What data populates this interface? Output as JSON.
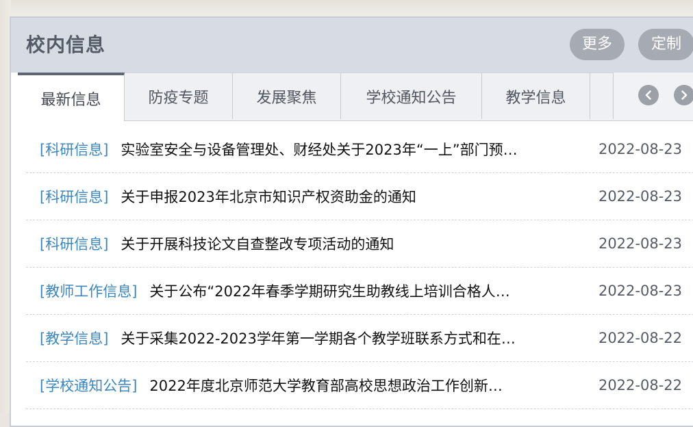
{
  "panel": {
    "title": "校内信息",
    "buttons": {
      "more": "更多",
      "custom": "定制"
    }
  },
  "tabs": [
    {
      "label": "最新信息",
      "active": true
    },
    {
      "label": "防疫专题"
    },
    {
      "label": "发展聚焦"
    },
    {
      "label": "学校通知公告"
    },
    {
      "label": "教学信息"
    }
  ],
  "icons": {
    "prev": "chevron-left-icon",
    "next": "chevron-right-icon"
  },
  "items": [
    {
      "category": "[科研信息]",
      "title": "实验室安全与设备管理处、财经处关于2023年“一上”部门预…",
      "date": "2022-08-23"
    },
    {
      "category": "[科研信息]",
      "title": "关于申报2023年北京市知识产权资助金的通知",
      "date": "2022-08-23"
    },
    {
      "category": "[科研信息]",
      "title": "关于开展科技论文自查整改专项活动的通知",
      "date": "2022-08-23"
    },
    {
      "category": "[教师工作信息]",
      "title": "关于公布“2022年春季学期研究生助教线上培训合格人…",
      "date": "2022-08-23"
    },
    {
      "category": "[教学信息]",
      "title": "关于采集2022-2023学年第一学期各个教学班联系方式和在…",
      "date": "2022-08-22"
    },
    {
      "category": "[学校通知公告]",
      "title": "2022年度北京师范大学教育部高校思想政治工作创新…",
      "date": "2022-08-22"
    }
  ],
  "colors": {
    "header_bg": "#d7dbe3",
    "category": "#3c86c0",
    "button_bg": "#a6aab3",
    "active_tab_border": "#5d6675"
  }
}
